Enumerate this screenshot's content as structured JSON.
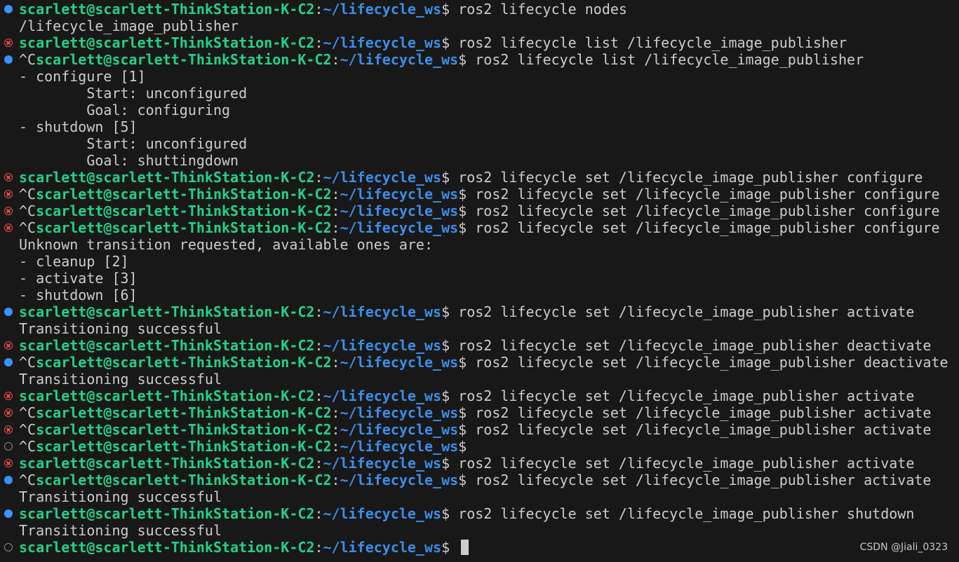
{
  "prompt": {
    "user_host": "scarlett@scarlett-ThinkStation-K-C2",
    "colon": ":",
    "path": "~/lifecycle_ws",
    "dollar": "$"
  },
  "ctrl_c": "^C",
  "lines": [
    {
      "type": "prompt",
      "status": "ok",
      "ctrlc": false,
      "cmd": " ros2 lifecycle nodes"
    },
    {
      "type": "output",
      "text": "/lifecycle_image_publisher"
    },
    {
      "type": "prompt",
      "status": "err",
      "ctrlc": false,
      "cmd": " ros2 lifecycle list /lifecycle_image_publisher"
    },
    {
      "type": "prompt",
      "status": "ok",
      "ctrlc": true,
      "cmd": " ros2 lifecycle list /lifecycle_image_publisher"
    },
    {
      "type": "output",
      "text": "- configure [1]"
    },
    {
      "type": "output",
      "text": "        Start: unconfigured"
    },
    {
      "type": "output",
      "text": "        Goal: configuring"
    },
    {
      "type": "output",
      "text": "- shutdown [5]"
    },
    {
      "type": "output",
      "text": "        Start: unconfigured"
    },
    {
      "type": "output",
      "text": "        Goal: shuttingdown"
    },
    {
      "type": "prompt",
      "status": "err",
      "ctrlc": false,
      "cmd": " ros2 lifecycle set /lifecycle_image_publisher configure"
    },
    {
      "type": "prompt",
      "status": "err",
      "ctrlc": true,
      "cmd": " ros2 lifecycle set /lifecycle_image_publisher configure"
    },
    {
      "type": "prompt",
      "status": "err",
      "ctrlc": true,
      "cmd": " ros2 lifecycle set /lifecycle_image_publisher configure"
    },
    {
      "type": "prompt",
      "status": "err",
      "ctrlc": true,
      "cmd": " ros2 lifecycle set /lifecycle_image_publisher configure"
    },
    {
      "type": "output",
      "text": "Unknown transition requested, available ones are:"
    },
    {
      "type": "output",
      "text": "- cleanup [2]"
    },
    {
      "type": "output",
      "text": "- activate [3]"
    },
    {
      "type": "output",
      "text": "- shutdown [6]"
    },
    {
      "type": "prompt",
      "status": "ok",
      "ctrlc": false,
      "cmd": " ros2 lifecycle set /lifecycle_image_publisher activate"
    },
    {
      "type": "output",
      "text": "Transitioning successful"
    },
    {
      "type": "prompt",
      "status": "err",
      "ctrlc": false,
      "cmd": " ros2 lifecycle set /lifecycle_image_publisher deactivate"
    },
    {
      "type": "prompt",
      "status": "ok",
      "ctrlc": true,
      "cmd": " ros2 lifecycle set /lifecycle_image_publisher deactivate"
    },
    {
      "type": "output",
      "text": "Transitioning successful"
    },
    {
      "type": "prompt",
      "status": "err",
      "ctrlc": false,
      "cmd": " ros2 lifecycle set /lifecycle_image_publisher activate"
    },
    {
      "type": "prompt",
      "status": "err",
      "ctrlc": true,
      "cmd": " ros2 lifecycle set /lifecycle_image_publisher activate"
    },
    {
      "type": "prompt",
      "status": "err",
      "ctrlc": true,
      "cmd": " ros2 lifecycle set /lifecycle_image_publisher activate"
    },
    {
      "type": "prompt",
      "status": "idle",
      "ctrlc": true,
      "cmd": ""
    },
    {
      "type": "prompt",
      "status": "err",
      "ctrlc": false,
      "cmd": " ros2 lifecycle set /lifecycle_image_publisher activate"
    },
    {
      "type": "prompt",
      "status": "ok",
      "ctrlc": true,
      "cmd": " ros2 lifecycle set /lifecycle_image_publisher activate"
    },
    {
      "type": "output",
      "text": "Transitioning successful"
    },
    {
      "type": "prompt",
      "status": "ok",
      "ctrlc": false,
      "cmd": " ros2 lifecycle set /lifecycle_image_publisher shutdown"
    },
    {
      "type": "output",
      "text": "Transitioning successful"
    },
    {
      "type": "prompt",
      "status": "idle",
      "ctrlc": false,
      "cmd": " ",
      "cursor": true
    }
  ],
  "watermark": "CSDN @Jiali_0323",
  "colors": {
    "background": "#181818",
    "text": "#cccccc",
    "user_host": "#23d18b",
    "path": "#3b8eea",
    "status_ok": "#3794ff",
    "status_err": "#f14c4c",
    "status_idle": "#8a8a8a"
  }
}
